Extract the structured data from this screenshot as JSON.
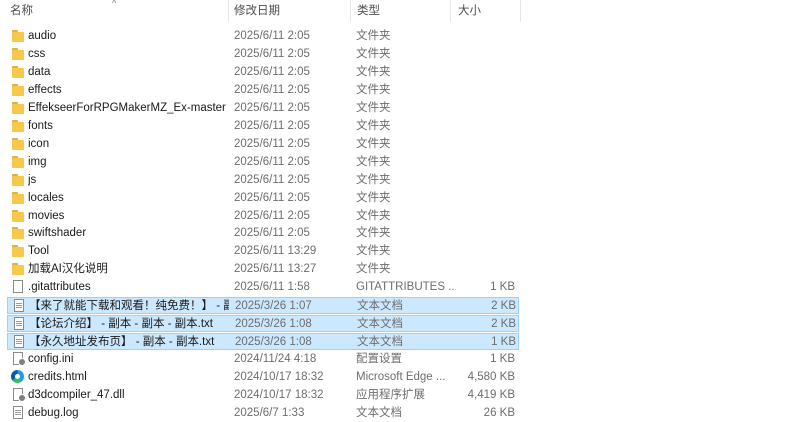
{
  "columns": {
    "name": "名称",
    "date": "修改日期",
    "type": "类型",
    "size": "大小",
    "sort_arrow": "^"
  },
  "files": [
    {
      "name": "audio",
      "date": "2025/6/11 2:05",
      "type": "文件夹",
      "size": "",
      "icon": "folder-icon",
      "selected": false
    },
    {
      "name": "css",
      "date": "2025/6/11 2:05",
      "type": "文件夹",
      "size": "",
      "icon": "folder-icon",
      "selected": false
    },
    {
      "name": "data",
      "date": "2025/6/11 2:05",
      "type": "文件夹",
      "size": "",
      "icon": "folder-icon",
      "selected": false
    },
    {
      "name": "effects",
      "date": "2025/6/11 2:05",
      "type": "文件夹",
      "size": "",
      "icon": "folder-icon",
      "selected": false
    },
    {
      "name": "EffekseerForRPGMakerMZ_Ex-master",
      "date": "2025/6/11 2:05",
      "type": "文件夹",
      "size": "",
      "icon": "folder-icon",
      "selected": false
    },
    {
      "name": "fonts",
      "date": "2025/6/11 2:05",
      "type": "文件夹",
      "size": "",
      "icon": "folder-icon",
      "selected": false
    },
    {
      "name": "icon",
      "date": "2025/6/11 2:05",
      "type": "文件夹",
      "size": "",
      "icon": "folder-icon",
      "selected": false
    },
    {
      "name": "img",
      "date": "2025/6/11 2:05",
      "type": "文件夹",
      "size": "",
      "icon": "folder-icon",
      "selected": false
    },
    {
      "name": "js",
      "date": "2025/6/11 2:05",
      "type": "文件夹",
      "size": "",
      "icon": "folder-icon",
      "selected": false
    },
    {
      "name": "locales",
      "date": "2025/6/11 2:05",
      "type": "文件夹",
      "size": "",
      "icon": "folder-icon",
      "selected": false
    },
    {
      "name": "movies",
      "date": "2025/6/11 2:05",
      "type": "文件夹",
      "size": "",
      "icon": "folder-icon",
      "selected": false
    },
    {
      "name": "swiftshader",
      "date": "2025/6/11 2:05",
      "type": "文件夹",
      "size": "",
      "icon": "folder-icon",
      "selected": false
    },
    {
      "name": "Tool",
      "date": "2025/6/11 13:29",
      "type": "文件夹",
      "size": "",
      "icon": "folder-icon",
      "selected": false
    },
    {
      "name": "加载AI汉化说明",
      "date": "2025/6/11 13:27",
      "type": "文件夹",
      "size": "",
      "icon": "folder-icon",
      "selected": false
    },
    {
      "name": ".gitattributes",
      "date": "2025/6/11 1:58",
      "type": "GITATTRIBUTES ...",
      "size": "1 KB",
      "icon": "file-icon",
      "selected": false
    },
    {
      "name": "【来了就能下载和观看！纯免费！】 - 副...",
      "date": "2025/3/26 1:07",
      "type": "文本文档",
      "size": "2 KB",
      "icon": "text-document-icon",
      "selected": true
    },
    {
      "name": "【论坛介绍】 - 副本 - 副本 - 副本.txt",
      "date": "2025/3/26 1:08",
      "type": "文本文档",
      "size": "2 KB",
      "icon": "text-document-icon",
      "selected": true
    },
    {
      "name": "【永久地址发布页】 - 副本 - 副本.txt",
      "date": "2025/3/26 1:08",
      "type": "文本文档",
      "size": "1 KB",
      "icon": "text-document-icon",
      "selected": true
    },
    {
      "name": "config.ini",
      "date": "2024/11/24 4:18",
      "type": "配置设置",
      "size": "1 KB",
      "icon": "config-settings-icon",
      "selected": false
    },
    {
      "name": "credits.html",
      "date": "2024/10/17 18:32",
      "type": "Microsoft Edge ...",
      "size": "4,580 KB",
      "icon": "edge-icon",
      "selected": false
    },
    {
      "name": "d3dcompiler_47.dll",
      "date": "2024/10/17 18:32",
      "type": "应用程序扩展",
      "size": "4,419 KB",
      "icon": "dll-icon",
      "selected": false
    },
    {
      "name": "debug.log",
      "date": "2025/6/7 1:33",
      "type": "文本文档",
      "size": "26 KB",
      "icon": "text-document-icon",
      "selected": false
    }
  ]
}
